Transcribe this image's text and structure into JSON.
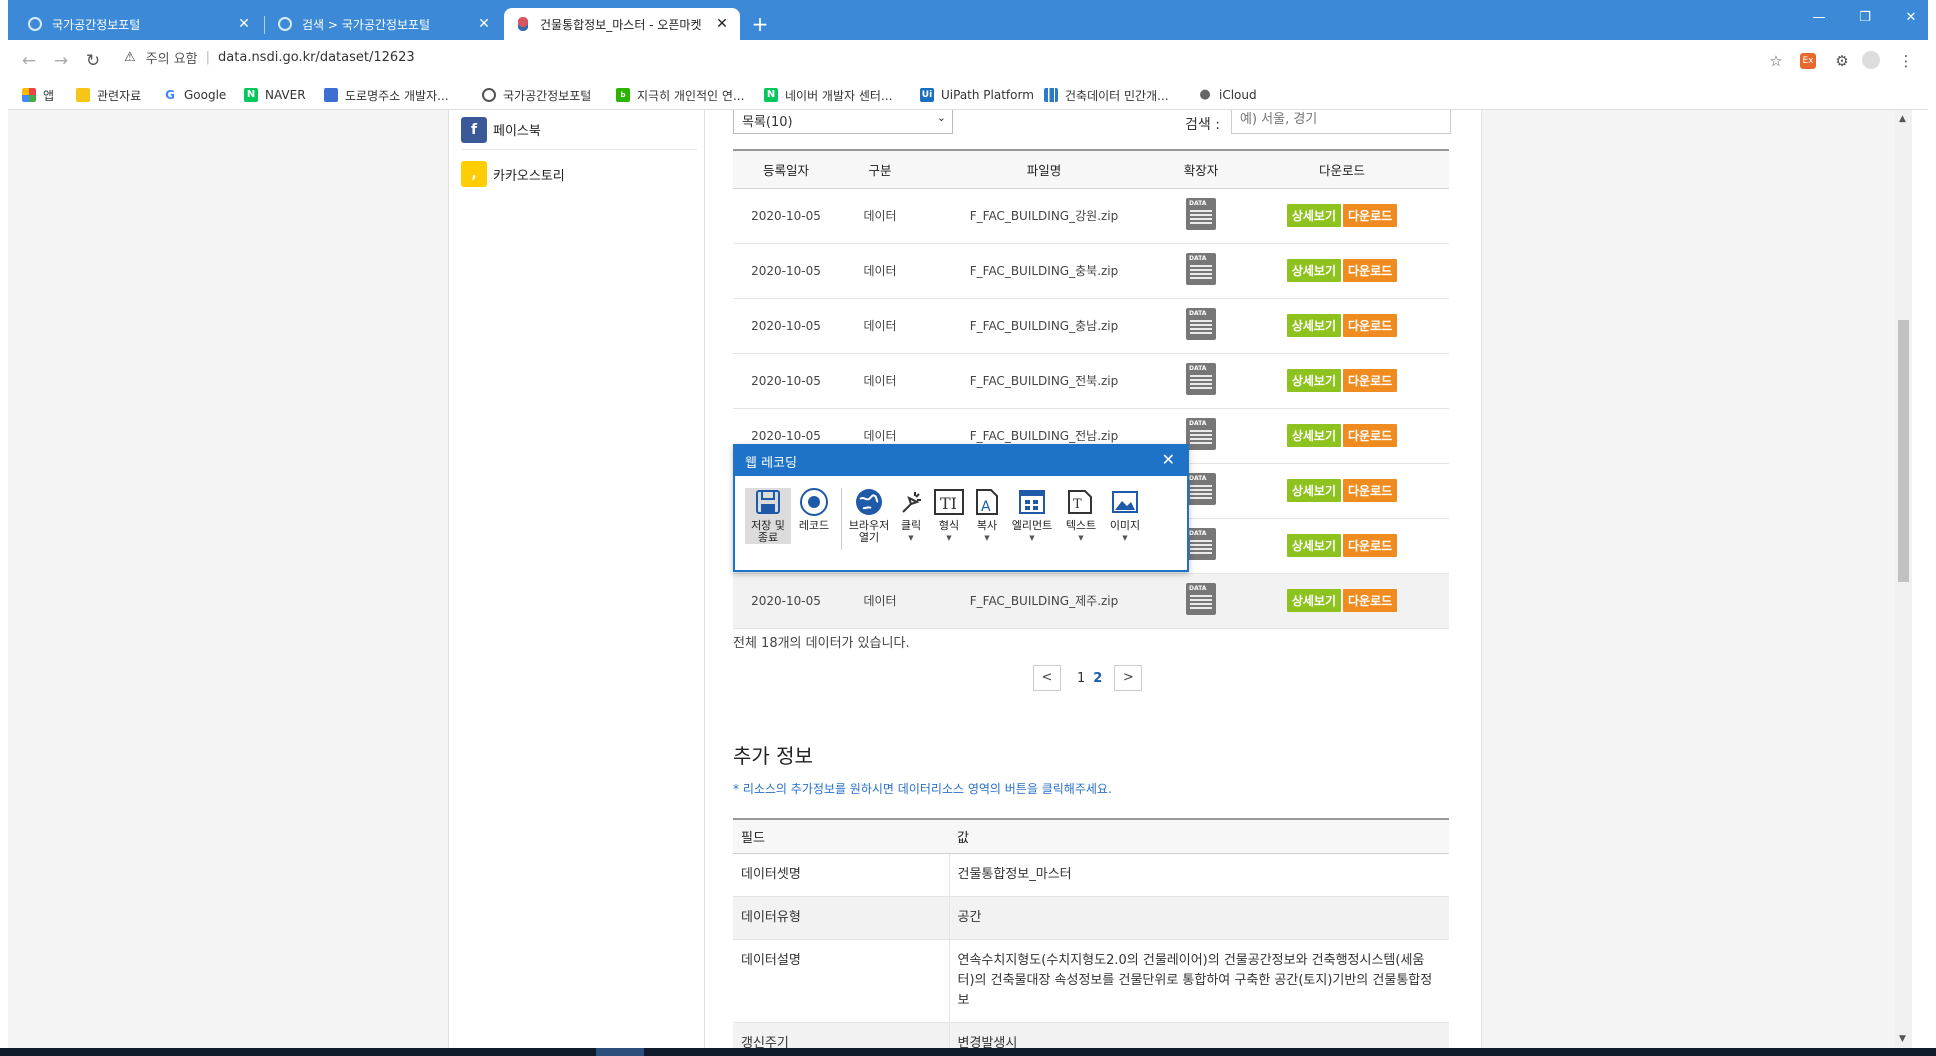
{
  "browser": {
    "tabs": [
      {
        "title": "국가공간정보포털",
        "close": "✕"
      },
      {
        "title": "검색 > 국가공간정보포털",
        "close": "✕"
      },
      {
        "title": "건물통합정보_마스터 - 오픈마켓",
        "close": "✕"
      }
    ],
    "new_tab": "+",
    "address": {
      "warning": "주의 요함",
      "url": "data.nsdi.go.kr/dataset/12623"
    },
    "bookmarks": [
      "앱",
      "관련자료",
      "Google",
      "NAVER",
      "도로명주소 개발자...",
      "국가공간정보포털",
      "지극히 개인적인 연...",
      "네이버 개발자 센터...",
      "UiPath Platform",
      "건축데이터 민간개...",
      "iCloud"
    ],
    "extension_badge": "Ex"
  },
  "sidebar": {
    "facebook": "페이스북",
    "kakaostory": "카카오스토리"
  },
  "list_controls": {
    "per_page": "목록(10)",
    "search_label": "검색 :",
    "search_placeholder": "예) 서울, 경기"
  },
  "file_table": {
    "headers": [
      "등록일자",
      "구분",
      "파일명",
      "확장자",
      "다운로드"
    ],
    "view_label": "상세보기",
    "download_label": "다운로드",
    "rows": [
      {
        "date": "2020-10-05",
        "type": "데이터",
        "file": "F_FAC_BUILDING_강원.zip"
      },
      {
        "date": "2020-10-05",
        "type": "데이터",
        "file": "F_FAC_BUILDING_충북.zip"
      },
      {
        "date": "2020-10-05",
        "type": "데이터",
        "file": "F_FAC_BUILDING_충남.zip"
      },
      {
        "date": "2020-10-05",
        "type": "데이터",
        "file": "F_FAC_BUILDING_전북.zip"
      },
      {
        "date": "2020-10-05",
        "type": "데이터",
        "file": "F_FAC_BUILDING_전남.zip"
      },
      {
        "date": "",
        "type": "",
        "file": ""
      },
      {
        "date": "",
        "type": "",
        "file": ""
      },
      {
        "date": "2020-10-05",
        "type": "데이터",
        "file": "F_FAC_BUILDING_제주.zip"
      }
    ]
  },
  "total_text": "전체 18개의 데이터가 있습니다.",
  "pagination": {
    "prev": "<",
    "pages": [
      "1",
      "2"
    ],
    "current": "2",
    "next": ">"
  },
  "extra_info": {
    "title": "추가 정보",
    "note": "* 리소스의 추가정보를 원하시면 데이터리소스 영역의 버튼을 클릭해주세요.",
    "headers": [
      "필드",
      "값"
    ],
    "rows": [
      {
        "field": "데이터셋명",
        "value": "건물통합정보_마스터"
      },
      {
        "field": "데이터유형",
        "value": "공간"
      },
      {
        "field": "데이터설명",
        "value": "연속수치지형도(수치지형도2.0의 건물레이어)의 건물공간정보와 건축행정시스템(세움터)의 건축물대장 속성정보를 건물단위로 통합하여 구축한 공간(토지)기반의 건물통합정보"
      },
      {
        "field": "갱신주기",
        "value": "변경발생시"
      }
    ]
  },
  "recording_dialog": {
    "title": "웹 레코딩",
    "tools": [
      {
        "label": "저장 및\n종료",
        "icon": "save-icon"
      },
      {
        "label": "레코드",
        "icon": "record-icon"
      },
      {
        "label": "브라우저\n열기",
        "icon": "globe-icon"
      },
      {
        "label": "클릭",
        "icon": "click-icon"
      },
      {
        "label": "형식",
        "icon": "type-into-icon"
      },
      {
        "label": "복사",
        "icon": "copy-text-icon"
      },
      {
        "label": "엘리먼트",
        "icon": "element-icon"
      },
      {
        "label": "텍스트",
        "icon": "text-icon"
      },
      {
        "label": "이미지",
        "icon": "image-icon"
      }
    ]
  }
}
